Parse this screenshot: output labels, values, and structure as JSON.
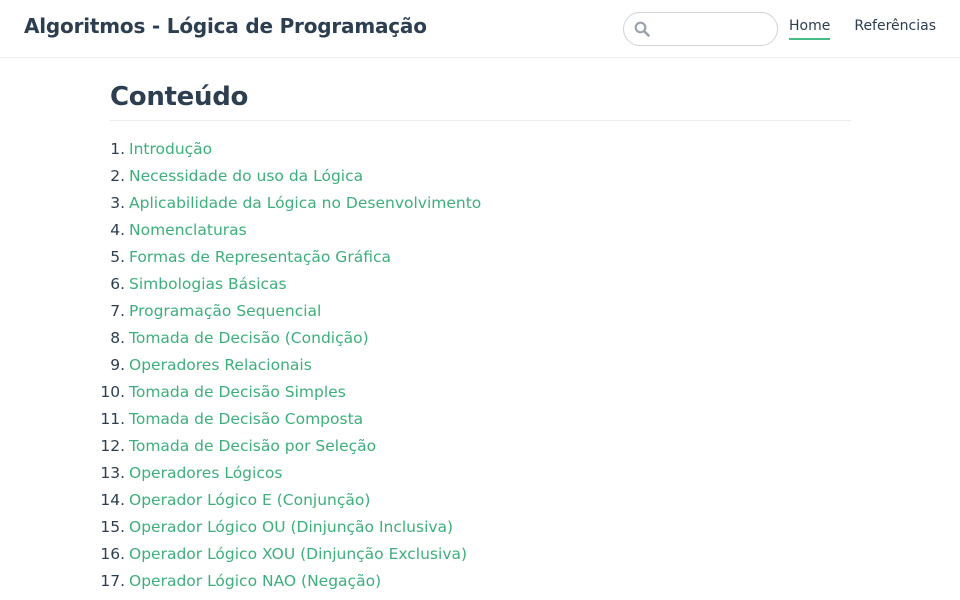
{
  "header": {
    "site_title": "Algoritmos - Lógica de Programação",
    "search": {
      "value": "",
      "placeholder": ""
    },
    "nav": [
      {
        "label": "Home",
        "active": true
      },
      {
        "label": "Referências",
        "active": false
      }
    ]
  },
  "main": {
    "heading": "Conteúdo",
    "toc": [
      {
        "num": "1.",
        "label": "Introdução"
      },
      {
        "num": "2.",
        "label": "Necessidade do uso da Lógica"
      },
      {
        "num": "3.",
        "label": "Aplicabilidade da Lógica no Desenvolvimento"
      },
      {
        "num": "4.",
        "label": "Nomenclaturas"
      },
      {
        "num": "5.",
        "label": "Formas de Representação Gráfica"
      },
      {
        "num": "6.",
        "label": "Simbologias Básicas"
      },
      {
        "num": "7.",
        "label": "Programação Sequencial"
      },
      {
        "num": "8.",
        "label": "Tomada de Decisão (Condição)"
      },
      {
        "num": "9.",
        "label": "Operadores Relacionais"
      },
      {
        "num": "10.",
        "label": "Tomada de Decisão Simples"
      },
      {
        "num": "11.",
        "label": "Tomada de Decisão Composta"
      },
      {
        "num": "12.",
        "label": "Tomada de Decisão por Seleção"
      },
      {
        "num": "13.",
        "label": "Operadores Lógicos"
      },
      {
        "num": "14.",
        "label": "Operador Lógico E (Conjunção)"
      },
      {
        "num": "15.",
        "label": "Operador Lógico OU (Dinjunção Inclusiva)"
      },
      {
        "num": "16.",
        "label": "Operador Lógico XOU (Dinjunção Exclusiva)"
      },
      {
        "num": "17.",
        "label": "Operador Lógico NAO (Negação)"
      }
    ]
  },
  "colors": {
    "link": "#3eaf7c",
    "text": "#2c3e50",
    "active_underline": "#46bd87",
    "border": "#eaecef"
  },
  "icons": {
    "search": "search-icon"
  }
}
